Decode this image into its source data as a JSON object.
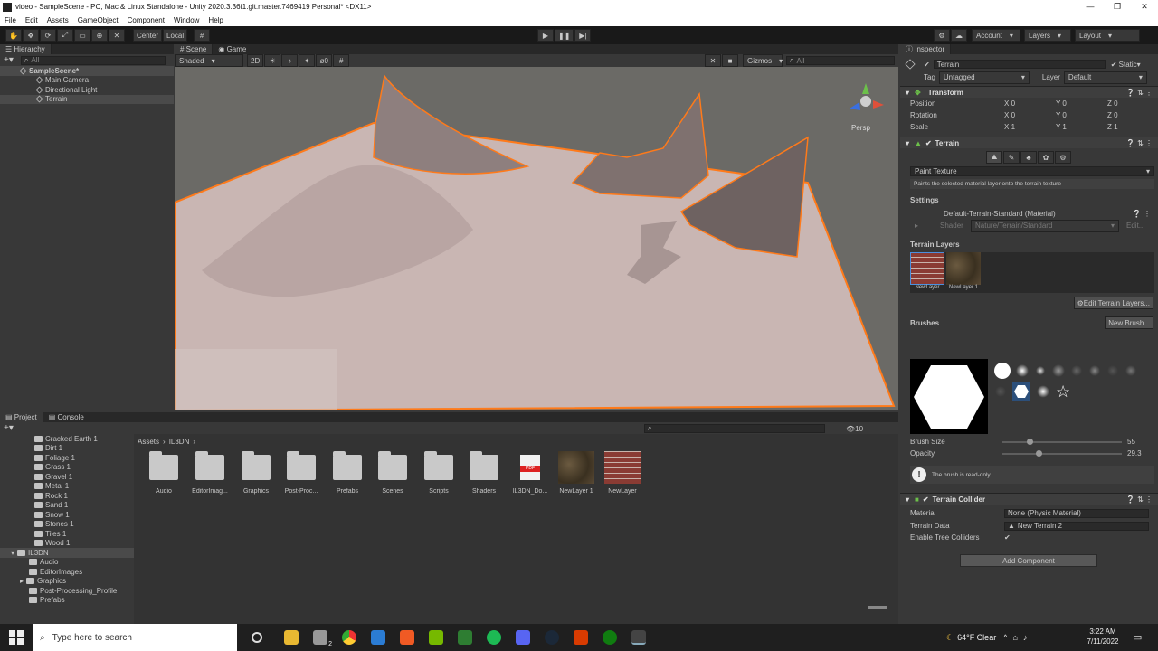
{
  "window": {
    "title": "video - SampleScene - PC, Mac & Linux Standalone - Unity 2020.3.36f1.git.master.7469419 Personal* <DX11>"
  },
  "menu": [
    "File",
    "Edit",
    "Assets",
    "GameObject",
    "Component",
    "Window",
    "Help"
  ],
  "toolbar": {
    "center_label": "Center",
    "local_label": "Local",
    "account_label": "Account",
    "layers_label": "Layers",
    "layout_label": "Layout"
  },
  "hierarchy": {
    "tab_label": "Hierarchy",
    "search_placeholder": "All",
    "scene_name": "SampleScene*",
    "items": [
      "Main Camera",
      "Directional Light",
      "Terrain"
    ]
  },
  "scene": {
    "tabs": [
      "Scene",
      "Game"
    ],
    "shading": "Shaded",
    "mode_2d": "2D",
    "gizmos_label": "Gizmos",
    "search_placeholder": "All",
    "persp_label": "Persp",
    "hidden_count": "0"
  },
  "project": {
    "tabs": [
      "Project",
      "Console"
    ],
    "tree": [
      "Cracked Earth 1",
      "Dirt 1",
      "Foliage 1",
      "Grass 1",
      "Gravel 1",
      "Metal 1",
      "Rock 1",
      "Sand 1",
      "Snow 1",
      "Stones 1",
      "Tiles 1",
      "Wood 1",
      "IL3DN",
      "Audio",
      "EditorImages",
      "Graphics",
      "Post-Processing_Profile",
      "Prefabs"
    ],
    "breadcrumb": [
      "Assets",
      "IL3DN"
    ],
    "assets": [
      "Audio",
      "EditorImag...",
      "Graphics",
      "Post-Proc...",
      "Prefabs",
      "Scenes",
      "Scripts",
      "Shaders",
      "IL3DN_Do...",
      "NewLayer 1",
      "NewLayer"
    ],
    "pdf_label": "PDF",
    "count_label": "10"
  },
  "inspector": {
    "tab_label": "Inspector",
    "object_name": "Terrain",
    "static_label": "Static",
    "tag_label": "Tag",
    "tag_value": "Untagged",
    "layer_label": "Layer",
    "layer_value": "Default",
    "transform": {
      "title": "Transform",
      "position": {
        "label": "Position",
        "x": "0",
        "y": "0",
        "z": "0"
      },
      "rotation": {
        "label": "Rotation",
        "x": "0",
        "y": "0",
        "z": "0"
      },
      "scale": {
        "label": "Scale",
        "x": "1",
        "y": "1",
        "z": "1"
      }
    },
    "terrain": {
      "title": "Terrain",
      "tool": "Paint Texture",
      "help": "Paints the selected material layer onto the terrain texture",
      "settings_label": "Settings",
      "material": "Default-Terrain-Standard (Material)",
      "shader_label": "Shader",
      "shader_value": "Nature/Terrain/Standard",
      "edit_label": "Edit...",
      "layers_label": "Terrain Layers",
      "layers": [
        "NewLayer",
        "NewLayer 1"
      ],
      "edit_layers_label": "Edit Terrain Layers...",
      "brushes_label": "Brushes",
      "new_brush_label": "New Brush...",
      "brush_size_label": "Brush Size",
      "brush_size_value": "55",
      "brush_size_fraction": 0.23,
      "opacity_label": "Opacity",
      "opacity_value": "29.3",
      "opacity_fraction": 0.3,
      "readonly_note": "The brush is read-only."
    },
    "collider": {
      "title": "Terrain Collider",
      "material_label": "Material",
      "material_value": "None (Physic Material)",
      "data_label": "Terrain Data",
      "data_value": "New Terrain 2",
      "trees_label": "Enable Tree Colliders"
    },
    "add_component": "Add Component"
  },
  "taskbar": {
    "search_placeholder": "Type here to search",
    "weather": "64°F  Clear",
    "time": "3:22 AM",
    "date": "7/11/2022",
    "badge": "2"
  },
  "colors": {
    "selection_orange": "#ff7a1a",
    "terrain": "#c9b6b3",
    "sky": "#6b6a66"
  }
}
